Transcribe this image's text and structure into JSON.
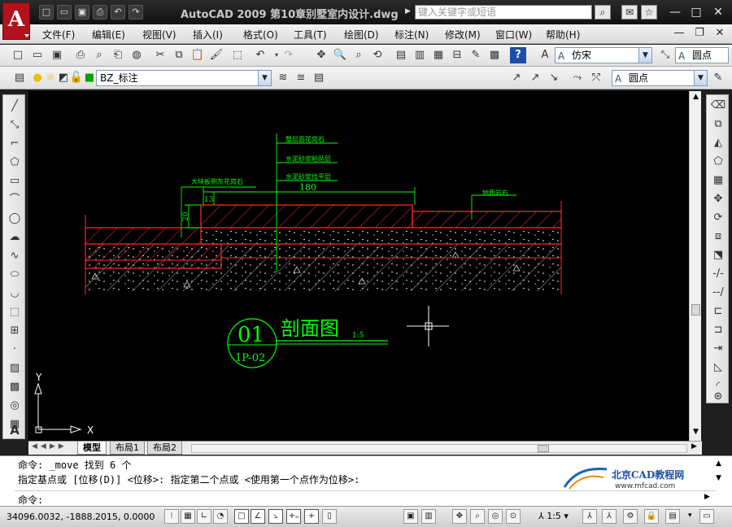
{
  "app": {
    "logo_letter": "A",
    "window_title": "AutoCAD 2009  第10章别墅室内设计.dwg",
    "search_placeholder": "键入关键字或短语"
  },
  "quick_access": [
    "new-icon",
    "open-icon",
    "save-icon",
    "print-icon",
    "undo-icon",
    "redo-icon"
  ],
  "menu": {
    "items": [
      "文件(F)",
      "编辑(E)",
      "视图(V)",
      "插入(I)",
      "格式(O)",
      "工具(T)",
      "绘图(D)",
      "标注(N)",
      "修改(M)",
      "窗口(W)",
      "帮助(H)"
    ]
  },
  "toolbar": {
    "text_style": "仿宋",
    "dim_style": "圆点",
    "layer": "BZ_标注",
    "multileader_style": "圆点"
  },
  "drawing": {
    "annotations": {
      "top1": "整层面花岗石",
      "top2": "水泥砂浆粘贴层",
      "top3": "水泥砂浆找平层",
      "left": "大块板侧灰花岗石",
      "right": "地质岩石",
      "dim_width": "180",
      "dim_small": "13",
      "dim_height": "20"
    },
    "section_number": "01",
    "section_ref": "1P-02",
    "section_title": "剖面图",
    "section_scale": "1:5",
    "ucs_y": "Y",
    "ucs_x": "X"
  },
  "layout_tabs": [
    "模型",
    "布局1",
    "布局2"
  ],
  "command": {
    "line1": "命令:  _move 找到 6 个",
    "line2": "指定基点或 [位移(D)] <位移>:  指定第二个点或 <使用第一个点作为位移>:",
    "prompt": "命令:",
    "watermark_title": "北京CAD教程网",
    "watermark_url": "www.mfcad.com"
  },
  "status": {
    "coordinates": "34096.0032, -1888.2015, 0.0000",
    "annotation_scale": "1:5"
  },
  "colors": {
    "canvas": "#000000",
    "hatch_red": "#ff2a2a",
    "annot_green": "#00ff00",
    "autocad_red": "#b1121c"
  }
}
